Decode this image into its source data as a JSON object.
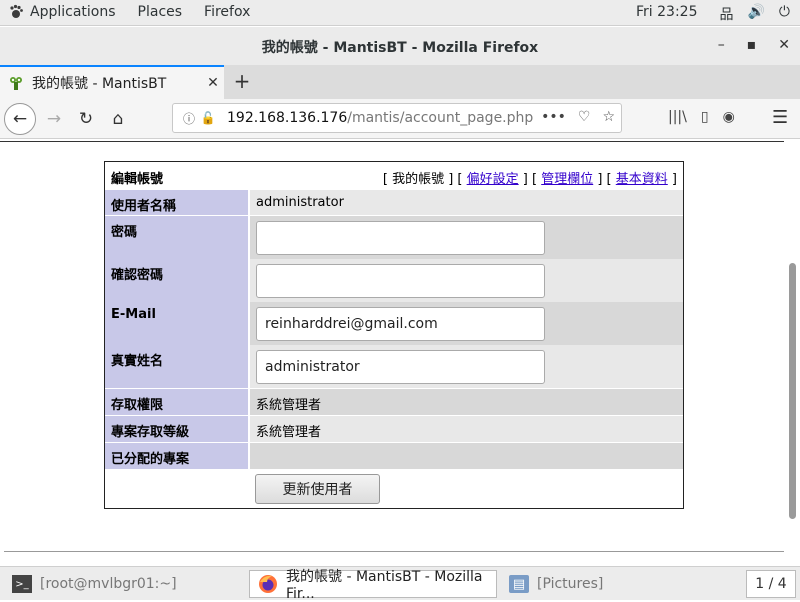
{
  "topbar": {
    "applications": "Applications",
    "places": "Places",
    "firefox": "Firefox",
    "clock": "Fri 23:25",
    "tray": [
      {
        "icon": "network-icon",
        "glyph": "品"
      },
      {
        "icon": "volume-icon",
        "glyph": "🔊"
      },
      {
        "icon": "power-icon",
        "glyph": "⏻"
      }
    ]
  },
  "window": {
    "title": "我的帳號 - MantisBT - Mozilla Firefox",
    "minimize": "–",
    "maximize": "▪",
    "close": "✕"
  },
  "tab": {
    "label": "我的帳號 - MantisBT",
    "close": "✕",
    "new_tab": "+"
  },
  "nav": {
    "back": "←",
    "forward": "→",
    "reload": "↻",
    "home": "⌂",
    "url_host": "192.168.136.176",
    "url_path": "/mantis/account_page.php",
    "more": "•••",
    "pocket": "♡",
    "bookmark": "☆",
    "library": "|||\\",
    "sidebar": "▯",
    "account": "◉",
    "menu": "☰"
  },
  "account": {
    "caption": "編輯帳號",
    "links": {
      "open1": "[ ",
      "my_account": "我的帳號",
      "sep1": " ] [ ",
      "preferences": "偏好設定",
      "sep2": " ] [ ",
      "manage_columns": "管理欄位",
      "sep3": " ] [ ",
      "profiles": "基本資料",
      "close": " ]"
    },
    "rows": {
      "username_label": "使用者名稱",
      "username_value": "administrator",
      "password_label": "密碼",
      "confirm_label": "確認密碼",
      "email_label": "E-Mail",
      "email_value": "reinharddrei@gmail.com",
      "realname_label": "真實姓名",
      "realname_value": "administrator",
      "access_label": "存取權限",
      "access_value": "系統管理者",
      "project_access_label": "專案存取等級",
      "project_access_value": "系統管理者",
      "assigned_label": "已分配的專案"
    },
    "submit": "更新使用者"
  },
  "taskbar": {
    "terminal": "[root@mvlbgr01:~]",
    "firefox": "我的帳號 - MantisBT - Mozilla Fir...",
    "pictures": "[Pictures]",
    "pager": "1 / 4"
  }
}
